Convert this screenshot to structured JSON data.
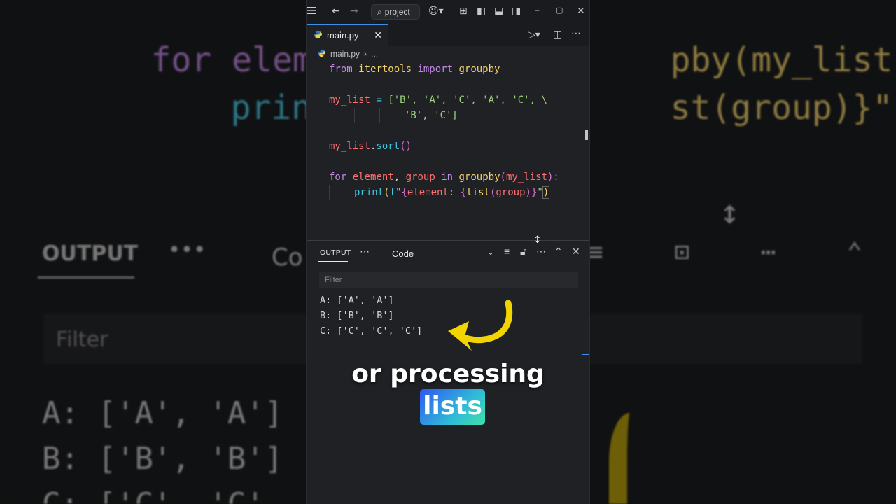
{
  "backdrop": {
    "top_left": "for element,",
    "top_right": "pby(my_list):",
    "print_left": "print(f\"",
    "print_right": "st(group)}\")",
    "output_label": "OUTPUT",
    "dots": "•••",
    "code_partial": "Co",
    "filter": "Filter",
    "res1": "A: ['A', 'A']",
    "res2": "B: ['B', 'B']",
    "res3": "C: ['C', 'C'"
  },
  "titlebar": {
    "search_label": "project"
  },
  "tab": {
    "filename": "main.py"
  },
  "breadcrumb": {
    "file": "main.py",
    "more": "..."
  },
  "code": {
    "line1": {
      "kw1": "from",
      "mod": "itertools",
      "kw2": "import",
      "name": "groupby"
    },
    "line3": {
      "var": "my_list",
      "eq": " = ",
      "items": "['B', 'A', 'C', 'A', 'C', \\"
    },
    "line4": {
      "items": "'B', 'C']"
    },
    "line6": {
      "var": "my_list",
      "dot": ".",
      "method": "sort",
      "parens": "()"
    },
    "line8": {
      "kw1": "for",
      "v1": "element",
      "comma": ", ",
      "v2": "group",
      "kw2": "in",
      "fn": "groupby",
      "open": "(",
      "arg": "my_list",
      "close": "):"
    },
    "line9": {
      "fn": "print",
      "open": "(",
      "prefix": "f",
      "q": "\"",
      "b1": "{",
      "v1": "element",
      "mid": ": ",
      "b2": "{",
      "fn2": "list",
      "o2": "(",
      "v2": "group",
      "c2": ")",
      "b3": "}",
      "q2": "\"",
      "close": ")"
    }
  },
  "panel": {
    "title": "OUTPUT",
    "channel": "Code",
    "filter_placeholder": "Filter",
    "output_lines": [
      "A: ['A', 'A']",
      "B: ['B', 'B']",
      "C: ['C', 'C', 'C']"
    ]
  },
  "caption": {
    "line1": "or processing",
    "highlight": "lists"
  },
  "colors": {
    "accent": "#3b8eea",
    "keyword": "#c586e8",
    "function": "#f3d268",
    "variable": "#ff6f6f",
    "string": "#9cd27a",
    "arrow": "#f2d400"
  }
}
